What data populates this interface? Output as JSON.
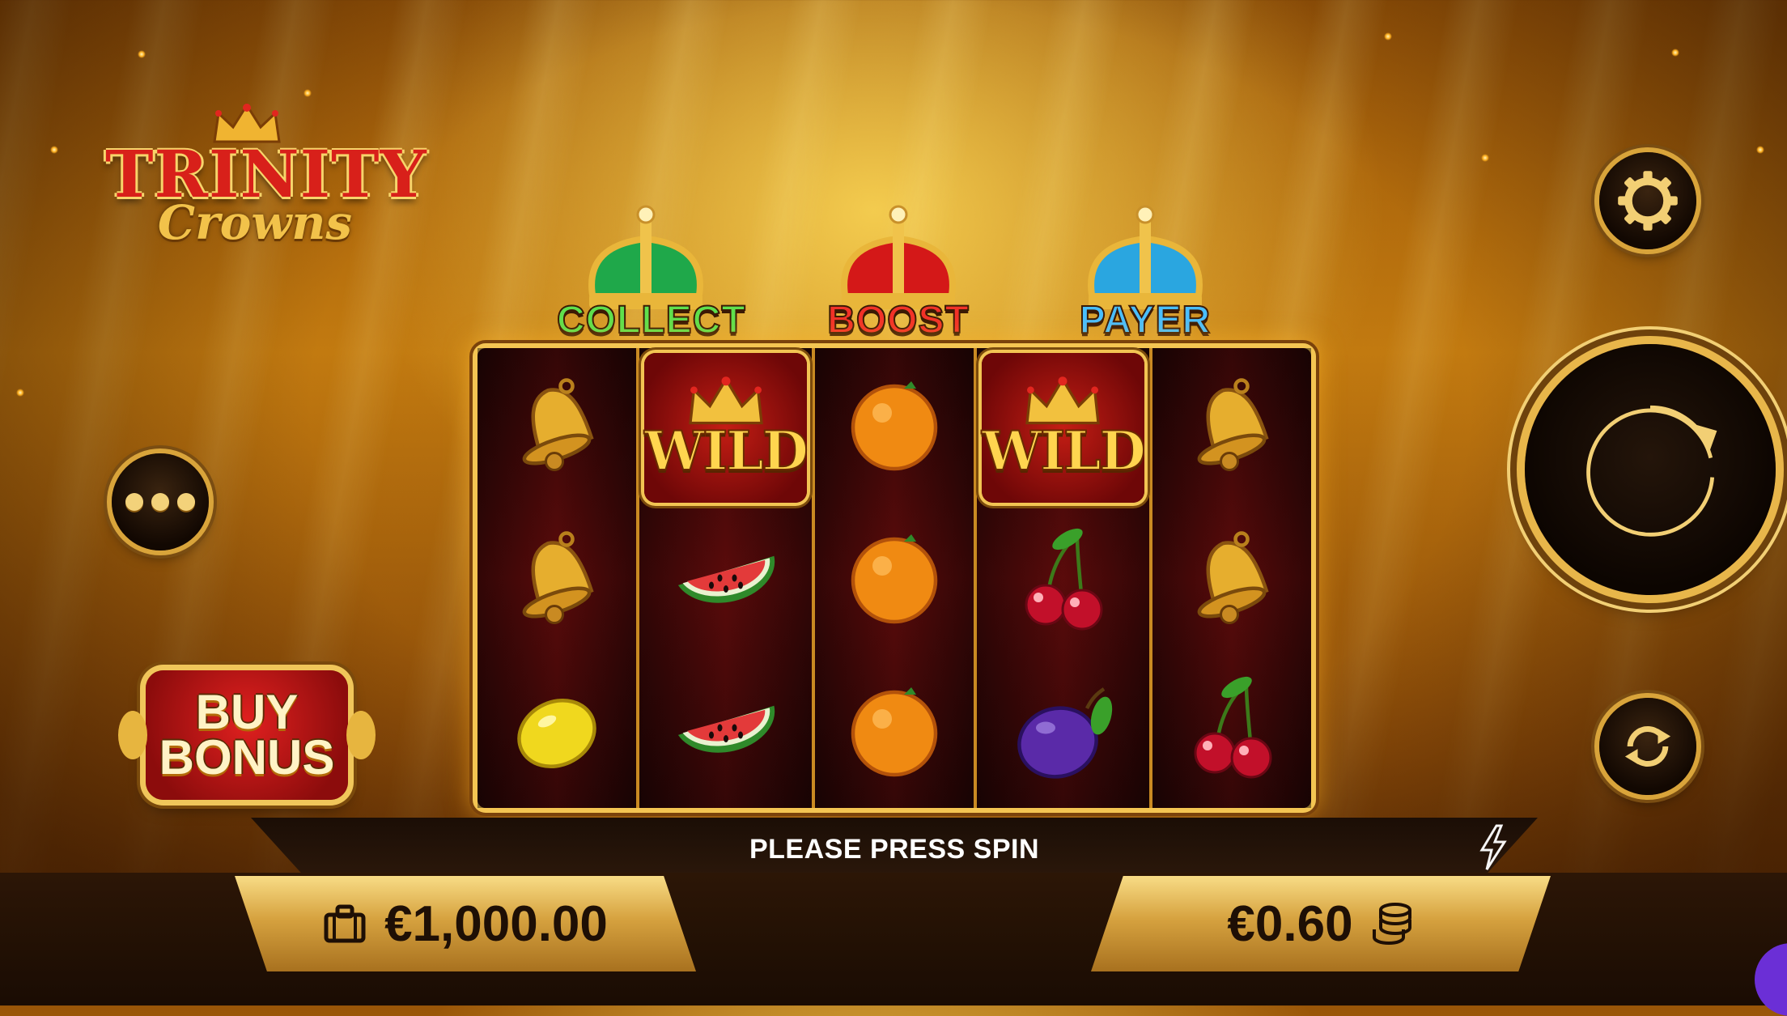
{
  "game": {
    "logo_title": "TRINITY",
    "logo_subtitle": "Crowns"
  },
  "features": [
    {
      "label": "COLLECT",
      "color": "#3fcf3a",
      "crown_color": "#1fa84a"
    },
    {
      "label": "BOOST",
      "color": "#e8221d",
      "crown_color": "#d41818"
    },
    {
      "label": "PAYER",
      "color": "#3db5ff",
      "crown_color": "#2aa6e0"
    }
  ],
  "reels": [
    [
      "bell",
      "bell",
      "lemon"
    ],
    [
      "wild",
      "watermelon",
      "watermelon"
    ],
    [
      "orange",
      "orange",
      "orange"
    ],
    [
      "wild",
      "cherries",
      "plum"
    ],
    [
      "bell",
      "bell",
      "cherries"
    ]
  ],
  "wild_label": "WILD",
  "buy_bonus": {
    "line1": "BUY",
    "line2": "BONUS"
  },
  "message": "PLEASE PRESS SPIN",
  "balance": "€1,000.00",
  "bet": "€0.60",
  "icons": {
    "menu": "more-dots-icon",
    "settings": "gear-icon",
    "spin": "spin-arrow-icon",
    "autoplay": "autoplay-icon",
    "turbo": "lightning-icon",
    "balance": "wallet-icon",
    "bet": "coins-icon"
  }
}
